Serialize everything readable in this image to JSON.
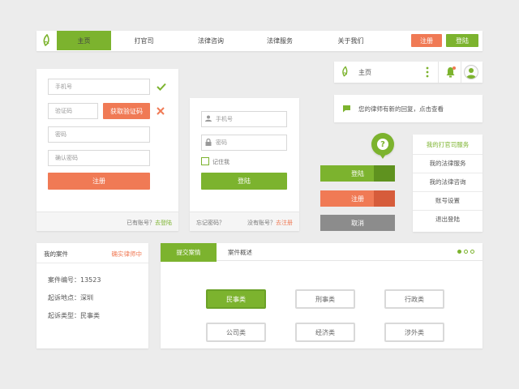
{
  "nav": {
    "items": [
      "主页",
      "打官司",
      "法律咨询",
      "法律服务",
      "关于我们"
    ],
    "register": "注册",
    "login": "登陆"
  },
  "login_form": {
    "phone_placeholder": "手机号",
    "code_placeholder": "验证码",
    "get_code": "获取验证码",
    "password_placeholder": "密码",
    "confirm_placeholder": "确认密码",
    "register_button": "注册",
    "has_account": "已有账号？",
    "login_link": "去登陆"
  },
  "login_card": {
    "phone_placeholder": "手机号",
    "password_placeholder": "密码",
    "remember": "记住我",
    "login_button": "登陆",
    "forgot": "忘记密码？",
    "no_account": "没有账号？",
    "register_link": "去注册"
  },
  "mini_header": {
    "home": "主页"
  },
  "notification": {
    "text": "您的律师有新的回复，点击查看"
  },
  "button_stack": {
    "login": "登陆",
    "register": "注册",
    "cancel": "取消"
  },
  "user_menu": {
    "items": [
      "我的打官司服务",
      "我的法律服务",
      "我的法律咨询",
      "账号设置",
      "退出登陆"
    ]
  },
  "case_panel": {
    "title": "我的案件",
    "action": "确实律师中",
    "case_no": "案件编号：13523",
    "location": "起诉地点：深圳",
    "type": "起诉类型：民事类"
  },
  "tabs_panel": {
    "tabs": [
      "提交案情",
      "案件概述"
    ],
    "categories": [
      "民事类",
      "刑事类",
      "行政类",
      "公司类",
      "经济类",
      "涉外类"
    ]
  },
  "colors": {
    "accent": "#7cb32e",
    "warning": "#f07a55",
    "muted": "#999999"
  }
}
